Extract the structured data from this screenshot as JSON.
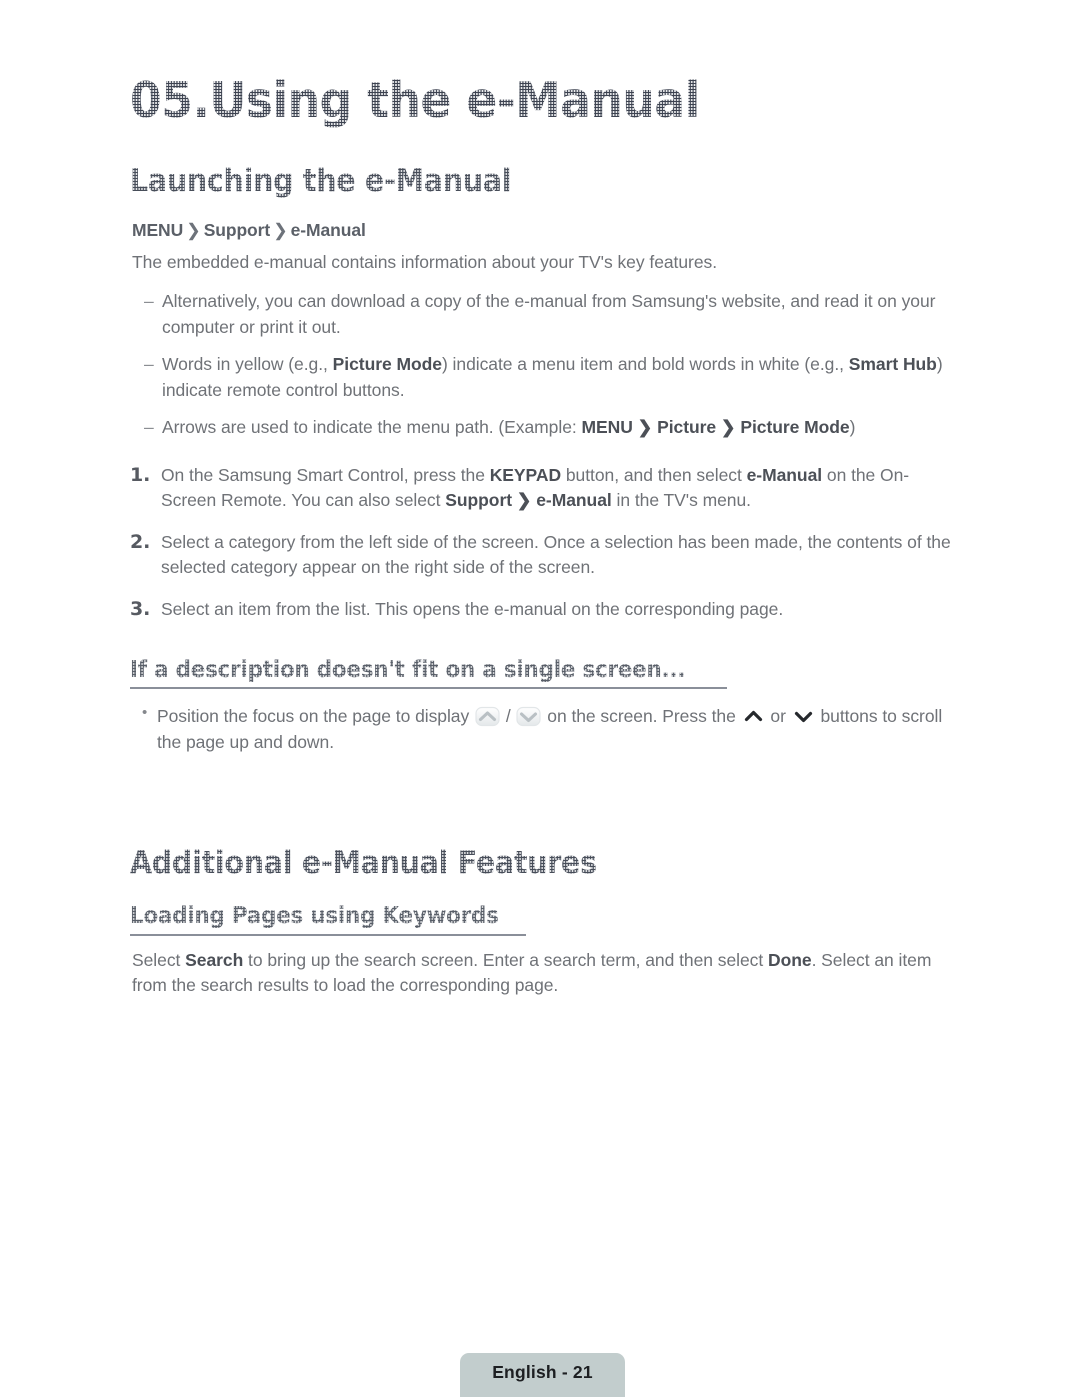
{
  "document": {
    "chapter_title": "05.Using the e-Manual",
    "sections": [
      {
        "heading": "Launching the e-Manual",
        "breadcrumb": {
          "items": [
            "MENU",
            "Support",
            "e-Manual"
          ],
          "separator": "❯"
        },
        "intro": "The embedded e-manual contains information about your TV's key features.",
        "dash_items": [
          {
            "marker": "–",
            "parts": [
              {
                "text": "Alternatively, you can download a copy of the e-manual from Samsung's website, and read it on your computer or print it out.",
                "bold": false
              }
            ]
          },
          {
            "marker": "–",
            "parts": [
              {
                "text": "Words in yellow (e.g., ",
                "bold": false
              },
              {
                "text": "Picture Mode",
                "bold": true
              },
              {
                "text": ") indicate a menu item and bold words in white (e.g., ",
                "bold": false
              },
              {
                "text": "Smart Hub",
                "bold": true
              },
              {
                "text": ") indicate remote control buttons.",
                "bold": false
              }
            ]
          },
          {
            "marker": "–",
            "parts": [
              {
                "text": "Arrows are used to indicate the menu path. (Example: ",
                "bold": false
              },
              {
                "text": "MENU",
                "bold": true
              },
              {
                "text": " ❯ ",
                "bold": true
              },
              {
                "text": "Picture",
                "bold": true
              },
              {
                "text": " ❯ ",
                "bold": true
              },
              {
                "text": "Picture Mode",
                "bold": true
              },
              {
                "text": ")",
                "bold": false
              }
            ]
          }
        ],
        "numbered_items": [
          {
            "number": "1.",
            "parts": [
              {
                "text": "On the Samsung Smart Control, press the ",
                "bold": false
              },
              {
                "text": "KEYPAD",
                "bold": true
              },
              {
                "text": " button, and then select ",
                "bold": false
              },
              {
                "text": "e-Manual",
                "bold": true
              },
              {
                "text": " on the On-Screen Remote. You can also select ",
                "bold": false
              },
              {
                "text": "Support",
                "bold": true
              },
              {
                "text": " ❯ ",
                "bold": true
              },
              {
                "text": "e-Manual",
                "bold": true
              },
              {
                "text": " in the TV's menu.",
                "bold": false
              }
            ]
          },
          {
            "number": "2.",
            "parts": [
              {
                "text": "Select a category from the left side of the screen. Once a selection has been made, the contents of the selected category appear on the right side of the screen.",
                "bold": false
              }
            ]
          },
          {
            "number": "3.",
            "parts": [
              {
                "text": "Select an item from the list. This opens the e-manual on the corresponding page.",
                "bold": false
              }
            ]
          }
        ]
      }
    ],
    "subsection_scroll": {
      "heading": "If a description doesn't fit on a single screen...",
      "bullet": {
        "marker": "•",
        "segments": [
          {
            "type": "text",
            "value": "Position the focus on the page to display "
          },
          {
            "type": "icon",
            "value": "chevron-up-button-icon"
          },
          {
            "type": "text",
            "value": " / "
          },
          {
            "type": "icon",
            "value": "chevron-down-button-icon"
          },
          {
            "type": "text",
            "value": " on the screen. Press the "
          },
          {
            "type": "icon",
            "value": "chevron-up-icon"
          },
          {
            "type": "text",
            "value": " or "
          },
          {
            "type": "icon",
            "value": "chevron-down-icon"
          },
          {
            "type": "text",
            "value": " buttons to scroll the page up and down."
          }
        ]
      }
    },
    "section_additional": {
      "heading": "Additional e-Manual Features",
      "subheading": "Loading Pages using Keywords",
      "body_parts": [
        {
          "text": "Select ",
          "bold": false
        },
        {
          "text": "Search",
          "bold": true
        },
        {
          "text": " to bring up the search screen. Enter a search term, and then select ",
          "bold": false
        },
        {
          "text": "Done",
          "bold": true
        },
        {
          "text": ". Select an item from the search results to load the corresponding page.",
          "bold": false
        }
      ]
    },
    "footer": {
      "label": "English - 21"
    }
  },
  "colors": {
    "heading": "#474d59",
    "body_text": "#6f7277",
    "bold_text": "#4c5057",
    "footer_badge_bg": "#c2cdcd",
    "footer_text": "#1d1f22"
  }
}
